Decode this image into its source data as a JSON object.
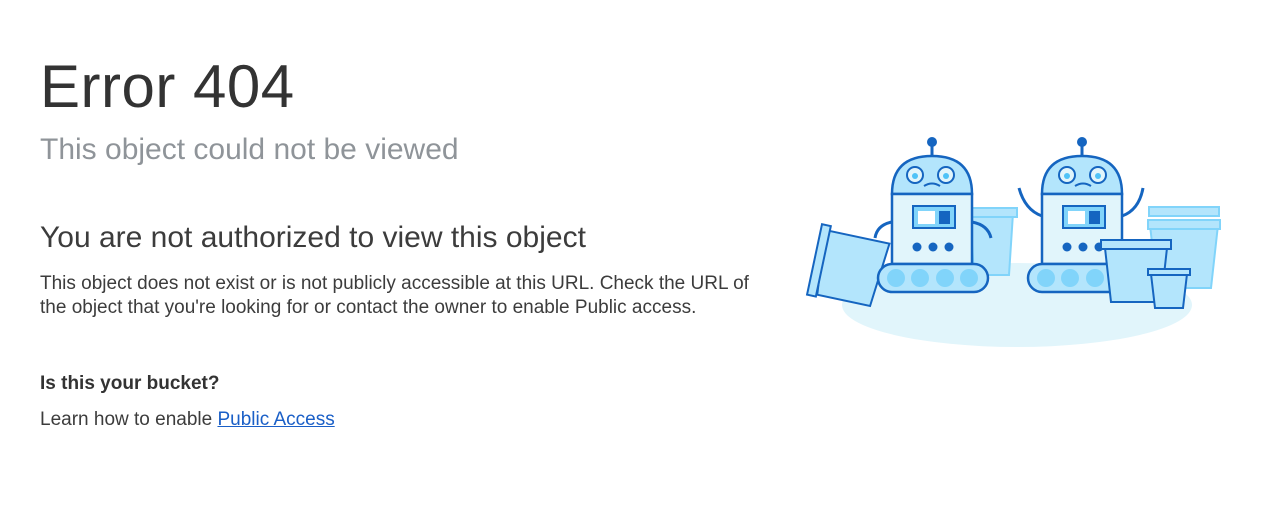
{
  "error": {
    "title": "Error 404",
    "subtitle": "This object could not be viewed"
  },
  "message": {
    "heading": "You are not authorized to view this object",
    "body": "This object does not exist or is not publicly accessible at this URL. Check the URL of the object that you're looking for or contact the owner to enable Public access."
  },
  "bucket": {
    "question": "Is this your bucket?",
    "learn_prefix": "Learn how to enable ",
    "link_label": "Public Access"
  },
  "illustration": {
    "icon": "sad-robots-illustration",
    "colors": {
      "outline": "#1565c0",
      "fill_light": "#b3e5fc",
      "fill_pale": "#e1f5fb",
      "fill_mid": "#81d4fa"
    }
  }
}
